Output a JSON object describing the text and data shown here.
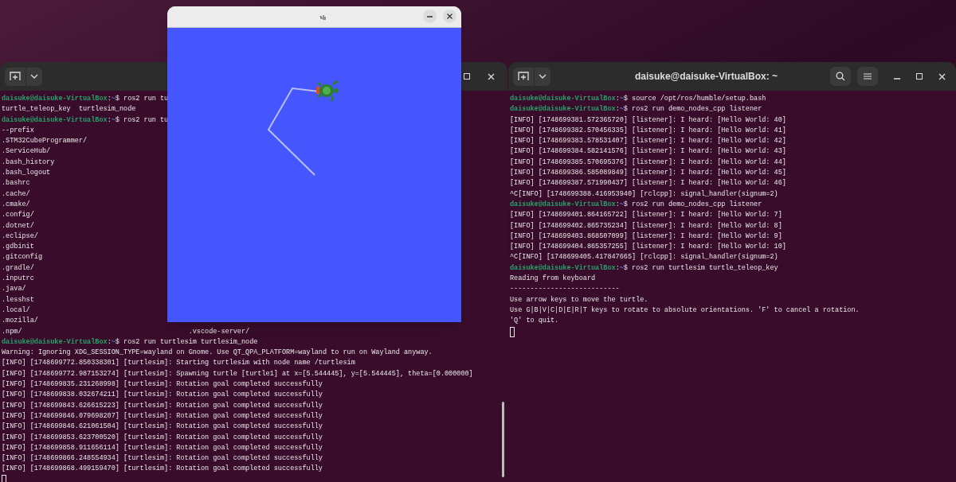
{
  "left_terminal": {
    "lines": [
      {
        "kind": "prompt",
        "user": "daisuke@daisuke-VirtualBox",
        "sep": ":",
        "path": "~",
        "symbol": "$ ",
        "command": "ros2 run tu"
      },
      {
        "kind": "output",
        "text": "turtle_teleop_key  turtlesim_node"
      },
      {
        "kind": "prompt",
        "user": "daisuke@daisuke-VirtualBox",
        "sep": ":",
        "path": "~",
        "symbol": "$ ",
        "command": "ros2 run tu"
      },
      {
        "kind": "output",
        "text": "--prefix"
      },
      {
        "kind": "output",
        "text": ".STM32CubeProgrammer/"
      },
      {
        "kind": "output",
        "text": ".ServiceHub/"
      },
      {
        "kind": "output",
        "text": ".bash_history"
      },
      {
        "kind": "output",
        "text": ".bash_logout"
      },
      {
        "kind": "output",
        "text": ".bashrc"
      },
      {
        "kind": "output",
        "text": ".cache/"
      },
      {
        "kind": "output",
        "text": ".cmake/"
      },
      {
        "kind": "output",
        "text": ".config/"
      },
      {
        "kind": "output",
        "text": ".dotnet/"
      },
      {
        "kind": "output",
        "text": ".eclipse/"
      },
      {
        "kind": "output",
        "text": ".gdbinit"
      },
      {
        "kind": "output",
        "text": ".gitconfig"
      },
      {
        "kind": "output",
        "text": ".gradle/"
      },
      {
        "kind": "output",
        "text": ".inputrc"
      },
      {
        "kind": "output",
        "text": ".java/"
      },
      {
        "kind": "output",
        "text": ".lesshst"
      },
      {
        "kind": "output",
        "text": ".local/"
      },
      {
        "kind": "output",
        "text": ".mozilla/"
      },
      {
        "kind": "columns",
        "columns": [
          ".npm/",
          ".vscode-server/"
        ]
      },
      {
        "kind": "prompt",
        "user": "daisuke@daisuke-VirtualBox",
        "sep": ":",
        "path": "~",
        "symbol": "$ ",
        "command": "ros2 run turtlesim turtlesim_node"
      },
      {
        "kind": "output",
        "text": "Warning: Ignoring XDG_SESSION_TYPE=wayland on Gnome. Use QT_QPA_PLATFORM=wayland to run on Wayland anyway."
      },
      {
        "kind": "output",
        "text": "[INFO] [1748699772.850338301] [turtlesim]: Starting turtlesim with node name /turtlesim"
      },
      {
        "kind": "output",
        "text": "[INFO] [1748699772.987153274] [turtlesim]: Spawning turtle [turtle1] at x=[5.544445], y=[5.544445], theta=[0.000000]"
      },
      {
        "kind": "output",
        "text": "[INFO] [1748699835.231268998] [turtlesim]: Rotation goal completed successfully"
      },
      {
        "kind": "output",
        "text": "[INFO] [1748699838.032674211] [turtlesim]: Rotation goal completed successfully"
      },
      {
        "kind": "output",
        "text": "[INFO] [1748699843.626615223] [turtlesim]: Rotation goal completed successfully"
      },
      {
        "kind": "output",
        "text": "[INFO] [1748699846.079698207] [turtlesim]: Rotation goal completed successfully"
      },
      {
        "kind": "output",
        "text": "[INFO] [1748699846.621061504] [turtlesim]: Rotation goal completed successfully"
      },
      {
        "kind": "output",
        "text": "[INFO] [1748699853.623700520] [turtlesim]: Rotation goal completed successfully"
      },
      {
        "kind": "output",
        "text": "[INFO] [1748699858.911656114] [turtlesim]: Rotation goal completed successfully"
      },
      {
        "kind": "output",
        "text": "[INFO] [1748699866.248554934] [turtlesim]: Rotation goal completed successfully"
      },
      {
        "kind": "output",
        "text": "[INFO] [1748699868.499159470] [turtlesim]: Rotation goal completed successfully"
      },
      {
        "kind": "cursor"
      }
    ]
  },
  "right_terminal": {
    "title": "daisuke@daisuke-VirtualBox: ~",
    "lines": [
      {
        "kind": "prompt",
        "user": "daisuke@daisuke-VirtualBox",
        "sep": ":",
        "path": "~",
        "symbol": "$ ",
        "command": "source /opt/ros/humble/setup.bash"
      },
      {
        "kind": "prompt",
        "user": "daisuke@daisuke-VirtualBox",
        "sep": ":",
        "path": "~",
        "symbol": "$ ",
        "command": "ros2 run demo_nodes_cpp listener"
      },
      {
        "kind": "output",
        "text": "[INFO] [1748699381.572365720] [listener]: I heard: [Hello World: 40]"
      },
      {
        "kind": "output",
        "text": "[INFO] [1748699382.570456335] [listener]: I heard: [Hello World: 41]"
      },
      {
        "kind": "output",
        "text": "[INFO] [1748699383.578531407] [listener]: I heard: [Hello World: 42]"
      },
      {
        "kind": "output",
        "text": "[INFO] [1748699384.582141576] [listener]: I heard: [Hello World: 43]"
      },
      {
        "kind": "output",
        "text": "[INFO] [1748699385.570695376] [listener]: I heard: [Hello World: 44]"
      },
      {
        "kind": "output",
        "text": "[INFO] [1748699386.585089849] [listener]: I heard: [Hello World: 45]"
      },
      {
        "kind": "output",
        "text": "[INFO] [1748699387.571990437] [listener]: I heard: [Hello World: 46]"
      },
      {
        "kind": "output",
        "text": "^C[INFO] [1748699388.416953940] [rclcpp]: signal_handler(signum=2)"
      },
      {
        "kind": "prompt",
        "user": "daisuke@daisuke-VirtualBox",
        "sep": ":",
        "path": "~",
        "symbol": "$ ",
        "command": "ros2 run demo_nodes_cpp listener"
      },
      {
        "kind": "output",
        "text": "[INFO] [1748699401.864165722] [listener]: I heard: [Hello World: 7]"
      },
      {
        "kind": "output",
        "text": "[INFO] [1748699402.865735234] [listener]: I heard: [Hello World: 8]"
      },
      {
        "kind": "output",
        "text": "[INFO] [1748699403.868507099] [listener]: I heard: [Hello World: 9]"
      },
      {
        "kind": "output",
        "text": "[INFO] [1748699404.865357255] [listener]: I heard: [Hello World: 10]"
      },
      {
        "kind": "output",
        "text": "^C[INFO] [1748699405.417847665] [rclcpp]: signal_handler(signum=2)"
      },
      {
        "kind": "prompt",
        "user": "daisuke@daisuke-VirtualBox",
        "sep": ":",
        "path": "~",
        "symbol": "$ ",
        "command": "ros2 run turtlesim turtle_teleop_key"
      },
      {
        "kind": "output",
        "text": "Reading from keyboard"
      },
      {
        "kind": "output",
        "text": "---------------------------"
      },
      {
        "kind": "output",
        "text": "Use arrow keys to move the turtle."
      },
      {
        "kind": "output",
        "text": "Use G|B|V|C|D|E|R|T keys to rotate to absolute orientations. 'F' to cancel a rotation."
      },
      {
        "kind": "output",
        "text": "'Q' to quit."
      },
      {
        "kind": "cursor"
      }
    ]
  }
}
